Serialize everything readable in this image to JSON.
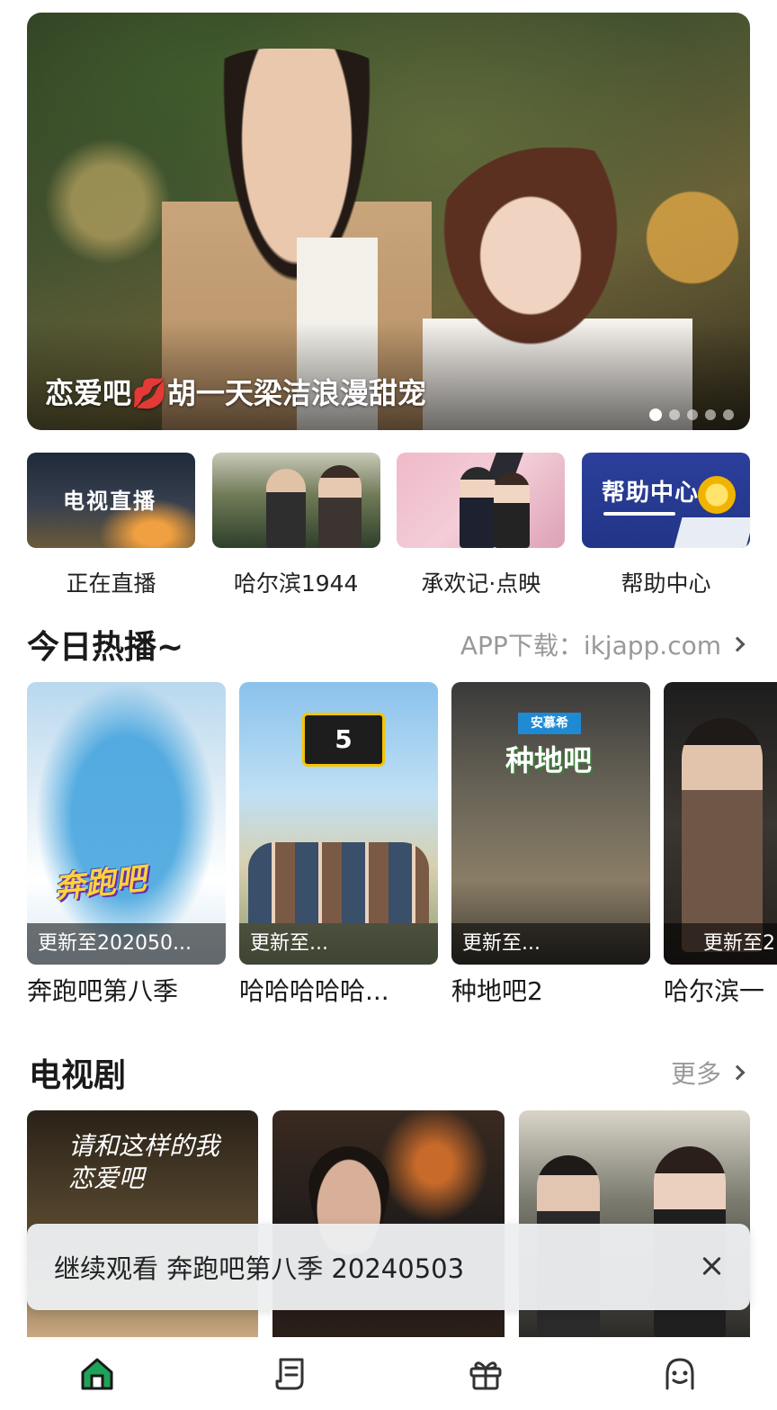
{
  "banner": {
    "caption_prefix": "恋爱吧",
    "caption_emoji": "💋",
    "caption_suffix": "胡一天梁洁浪漫甜宠",
    "active_dot": 0,
    "dot_count": 5
  },
  "quick_entries": [
    {
      "label": "正在直播",
      "thumb_text": "电视直播"
    },
    {
      "label": "哈尔滨1944",
      "thumb_text": ""
    },
    {
      "label": "承欢记·点映",
      "thumb_text": ""
    },
    {
      "label": "帮助中心",
      "thumb_text": "帮助中心"
    }
  ],
  "today_hot": {
    "title": "今日热播~",
    "right_text": "APP下载：ikjapp.com",
    "items": [
      {
        "title": "奔跑吧第八季",
        "update": "更新至202050...",
        "poster_logo": "奔跑吧"
      },
      {
        "title": "哈哈哈哈哈...",
        "update": "更新至...",
        "poster_badge": "5"
      },
      {
        "title": "种地吧2",
        "update": "更新至...",
        "poster_sign": "安慕希",
        "poster_title": "种地吧"
      },
      {
        "title": "哈尔滨一",
        "update": "更新至2"
      }
    ]
  },
  "tv_drama": {
    "title": "电视剧",
    "more": "更多",
    "first_poster_title": "请和这样的我恋爱吧"
  },
  "continue_watching": {
    "text": "继续观看 奔跑吧第八季 20240503"
  },
  "bottom_nav": {
    "items": [
      {
        "icon": "home-icon",
        "active": true
      },
      {
        "icon": "list-icon",
        "active": false
      },
      {
        "icon": "gift-icon",
        "active": false
      },
      {
        "icon": "profile-icon",
        "active": false
      }
    ]
  },
  "colors": {
    "accent": "#1fa35a",
    "nav_icon": "#333333"
  }
}
